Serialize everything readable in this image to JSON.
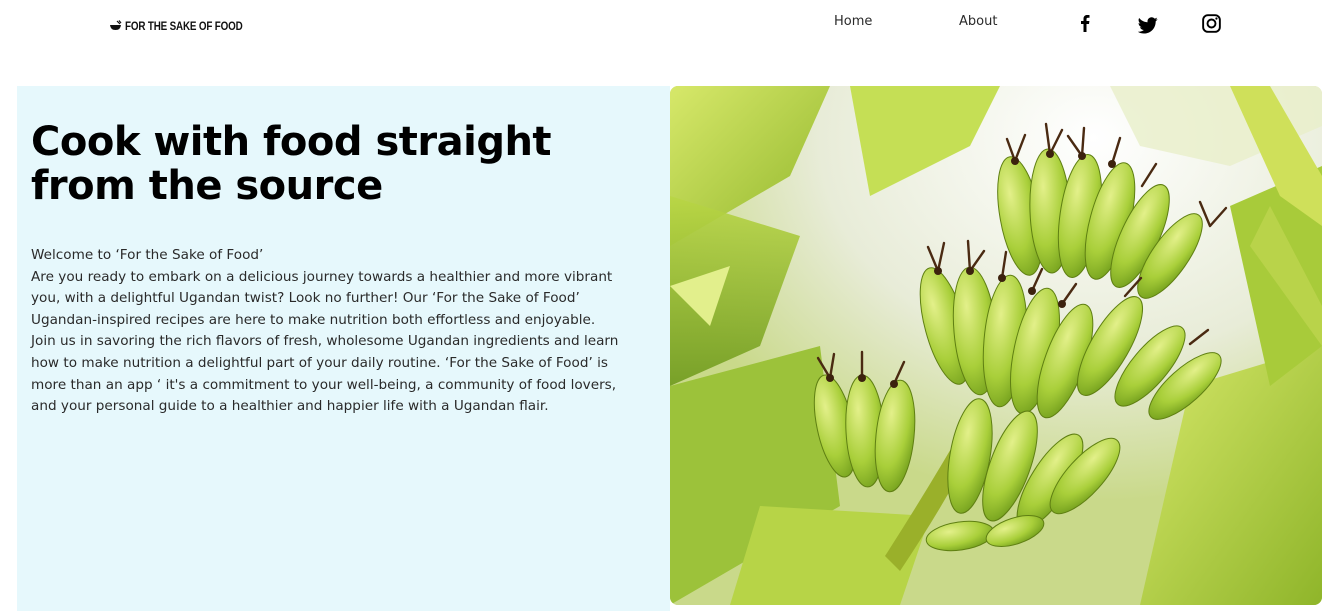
{
  "header": {
    "logo_text": "FOR THE SAKE OF FOOD",
    "nav": [
      {
        "label": "Home"
      },
      {
        "label": "About"
      }
    ],
    "social": [
      {
        "icon": "facebook-icon"
      },
      {
        "icon": "twitter-icon"
      },
      {
        "icon": "instagram-icon"
      }
    ]
  },
  "hero": {
    "title": "Cook with food straight from the source",
    "paragraphs": [
      "Welcome to ‘For the Sake of Food’",
      "Are you ready to embark on a delicious journey towards a healthier and more vibrant you, with a delightful Ugandan twist? Look no further! Our ‘For the Sake of Food’ Ugandan-inspired recipes are here to make nutrition both effortless and enjoyable.",
      "Join us in savoring the rich flavors of fresh, wholesome Ugandan ingredients and learn how to make nutrition a delightful part of your daily routine. ‘For the Sake of Food’ is more than an app ‘ it's a commitment to your well-being, a community of food lovers, and your personal guide to a healthier and happier life with a Ugandan flair."
    ],
    "image": {
      "subject": "green-banana-bunch-photo"
    }
  },
  "colors": {
    "hero_background": "#e6f8fc",
    "banana_green": "#b5d33a",
    "text": "#2a2a2a"
  }
}
